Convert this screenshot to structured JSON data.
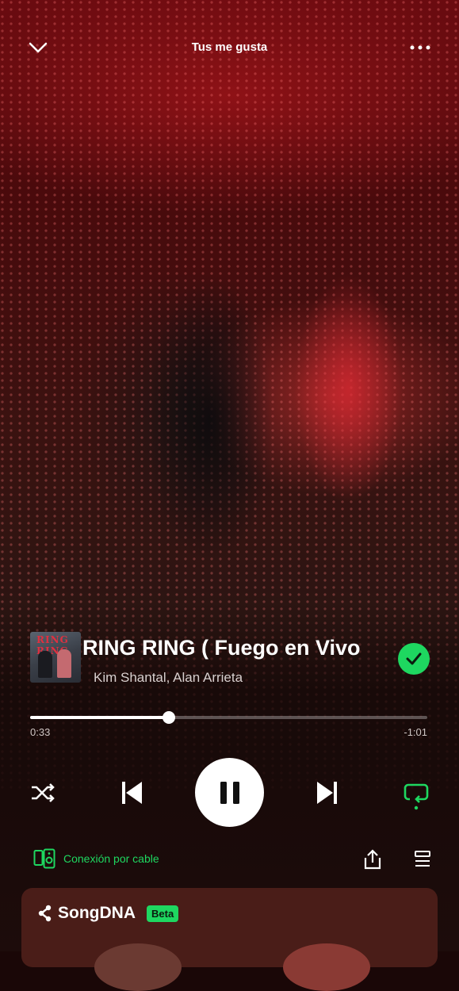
{
  "header": {
    "title": "Tus me gusta",
    "collapse_icon": "chevron-down-icon",
    "more_icon": "more-horizontal-icon"
  },
  "track": {
    "cover_text": "RING RING",
    "title": "RING RING ( Fuego en Vivo",
    "artists": "Kim Shantal, Alan Arrieta",
    "liked": true
  },
  "progress": {
    "elapsed": "0:33",
    "remaining": "-1:01",
    "fraction": 0.35
  },
  "controls": {
    "shuffle_icon": "shuffle-icon",
    "previous_icon": "skip-previous-icon",
    "play_pause_icon": "pause-icon",
    "next_icon": "skip-next-icon",
    "repeat_icon": "repeat-icon"
  },
  "footer": {
    "device_label": "Conexión por cable",
    "share_icon": "share-icon",
    "queue_icon": "queue-icon"
  },
  "songdna": {
    "title": "SongDNA",
    "badge": "Beta"
  },
  "colors": {
    "accent": "#1ed760",
    "background": "#1a0707"
  }
}
